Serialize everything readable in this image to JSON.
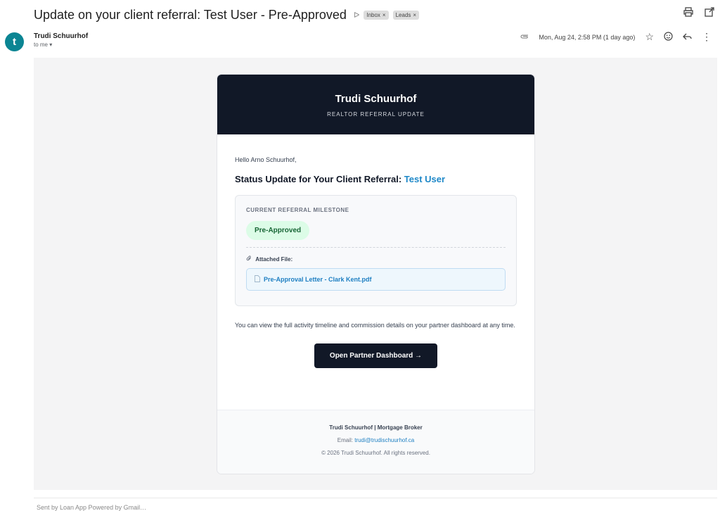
{
  "email": {
    "subject": "Update on your client referral: Test User - Pre-Approved",
    "labels": [
      {
        "name": "Inbox",
        "remove": "×"
      },
      {
        "name": "Leads",
        "remove": "×"
      }
    ],
    "sender_initial": "t",
    "sender_name": "Trudi Schuurhof",
    "recipient": "to me ▾",
    "timestamp": "Mon, Aug 24, 2:58 PM (1 day ago)"
  },
  "icons": {
    "importance": "importance-marker-icon",
    "print": "print-icon",
    "open_new_window": "open-in-new-window-icon",
    "attachment": "paperclip-icon",
    "star": "star-icon",
    "emoji": "emoji-icon",
    "reply": "reply-icon",
    "more": "more-vertical-icon",
    "file": "document-icon"
  },
  "message": {
    "header_title": "Trudi Schuurhof",
    "header_subtitle": "REALTOR REFERRAL UPDATE",
    "greeting": "Hello Arno Schuurhof,",
    "status_prefix": "Status Update for Your Client Referral:",
    "client_name": "Test User",
    "milestone_label": "CURRENT REFERRAL MILESTONE",
    "milestone_value": "Pre-Approved",
    "attached_label": "Attached File:",
    "attached_file": "Pre-Approval Letter - Clark Kent.pdf",
    "body_text": "You can view the full activity timeline and commission details on your partner dashboard at any time.",
    "cta_label": "Open Partner Dashboard →",
    "footer_name": "Trudi Schuurhof | Mortgage Broker",
    "footer_email_prefix": "Email:",
    "footer_email": "trudi@trudischuurhof.ca",
    "footer_copyright": "© 2026 Trudi Schuurhof. All rights reserved."
  },
  "colors": {
    "header_bg": "#111827",
    "accent_link": "#1e88c8",
    "pill_bg": "#dcfce7",
    "pill_text": "#166534",
    "avatar_bg": "#0b8593"
  },
  "bottom_partial_text": "Sent by Loan App Powered by Gmail…"
}
